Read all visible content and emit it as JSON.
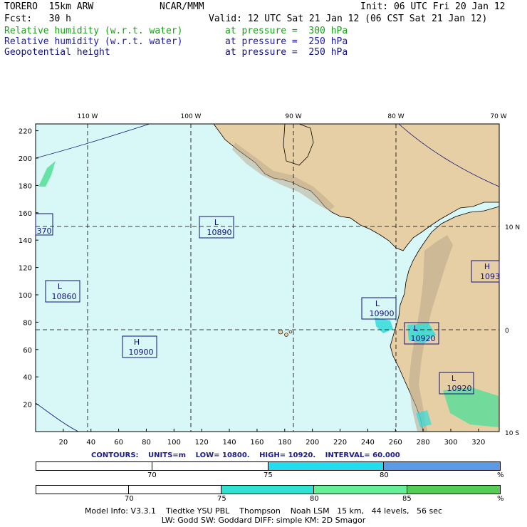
{
  "header": {
    "model": "TORERO  15km ARW",
    "org": "NCAR/MMM",
    "init": "Init: 06 UTC Fri 20 Jan 12",
    "fcst": "Fcst:   30 h",
    "valid": "Valid: 12 UTC Sat 21 Jan 12 (06 CST Sat 21 Jan 12)",
    "fields": [
      {
        "name": "Relative humidity (w.r.t. water)",
        "level": "at pressure =  300 hPa",
        "color": "#1a9e1a"
      },
      {
        "name": "Relative humidity (w.r.t. water)",
        "level": "at pressure =  250 hPa",
        "color": "#1a1aa8"
      },
      {
        "name": "Geopotential height",
        "level": "at pressure =  250 hPa",
        "color": "#10107a"
      }
    ]
  },
  "map": {
    "top_labels": [
      "110 W",
      "100 W",
      "90 W",
      "80 W",
      "70 W"
    ],
    "right_labels": [
      "10 N",
      "0",
      "10 S"
    ],
    "left_ticks": [
      "20",
      "40",
      "60",
      "80",
      "100",
      "120",
      "140",
      "160",
      "180",
      "200",
      "220"
    ],
    "bottom_ticks": [
      "20",
      "40",
      "60",
      "80",
      "100",
      "120",
      "140",
      "160",
      "180",
      "200",
      "220",
      "240",
      "260",
      "280",
      "300",
      "320"
    ],
    "ocean_color": "#d8f7f7",
    "land_color": "#e6cfa4",
    "centers": [
      {
        "type": "L",
        "value": "10890"
      },
      {
        "type": "L",
        "value": "10860"
      },
      {
        "type": "H",
        "value": "10900"
      },
      {
        "type": "L",
        "value": "10900"
      },
      {
        "type": "L",
        "value": "10920"
      },
      {
        "type": "L",
        "value": "10920"
      },
      {
        "type": "H",
        "value": "1093"
      },
      {
        "type": "",
        "value": "370"
      }
    ]
  },
  "contours": {
    "label": "CONTOURS:",
    "units": "UNITS=m",
    "low": "LOW=   10800.",
    "high": "HIGH=   10920.",
    "interval": "INTERVAL=    60.000"
  },
  "colorbar1": {
    "colors": [
      "#ffffff",
      "#ffffff",
      "#22ddee",
      "#5a9ae6"
    ],
    "labels": [
      "70",
      "75",
      "80",
      "%"
    ]
  },
  "colorbar2": {
    "colors": [
      "#ffffff",
      "#ffffff",
      "#30e0d0",
      "#66ee99",
      "#55cc55"
    ],
    "labels": [
      "70",
      "75",
      "80",
      "85",
      "%"
    ]
  },
  "footer": {
    "line1": "Model Info: V3.3.1    Tiedtke YSU PBL    Thompson    Noah LSM   15 km,   44 levels,   56 sec",
    "line2": "LW: Godd SW: Goddard DIFF: simple KM: 2D Smagor"
  }
}
